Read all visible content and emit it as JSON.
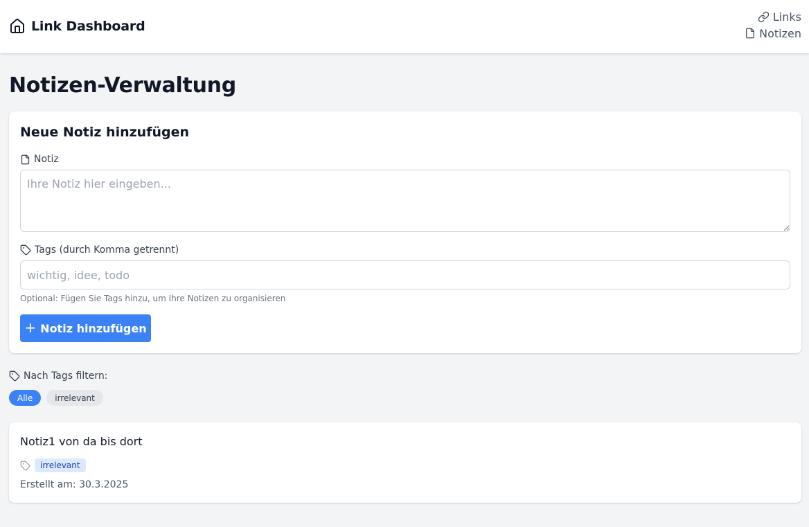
{
  "header": {
    "brand_title": "Link Dashboard",
    "nav": [
      {
        "label": "Links",
        "icon": "link-icon"
      },
      {
        "label": "Notizen",
        "icon": "file-icon"
      }
    ]
  },
  "page": {
    "title": "Notizen-Verwaltung"
  },
  "form": {
    "title": "Neue Notiz hinzufügen",
    "note_label": "Notiz",
    "note_placeholder": "Ihre Notiz hier eingeben...",
    "note_value": "",
    "tags_label": "Tags (durch Komma getrennt)",
    "tags_placeholder": "wichtig, idee, todo",
    "tags_value": "",
    "hint": "Optional: Fügen Sie Tags hinzu, um Ihre Notizen zu organisieren",
    "submit_label": "Notiz hinzufügen"
  },
  "filter": {
    "label": "Nach Tags filtern:",
    "chips": [
      {
        "label": "Alle",
        "active": true
      },
      {
        "label": "irrelevant",
        "active": false
      }
    ]
  },
  "notes": [
    {
      "text": "Notiz1 von da bis dort",
      "tags": [
        "irrelevant"
      ],
      "created": "Erstellt am: 30.3.2025"
    }
  ],
  "colors": {
    "primary": "#3b82f6",
    "background": "#f3f4f6",
    "card": "#ffffff",
    "tag_bg": "#dbeafe",
    "tag_text": "#1e40af"
  }
}
